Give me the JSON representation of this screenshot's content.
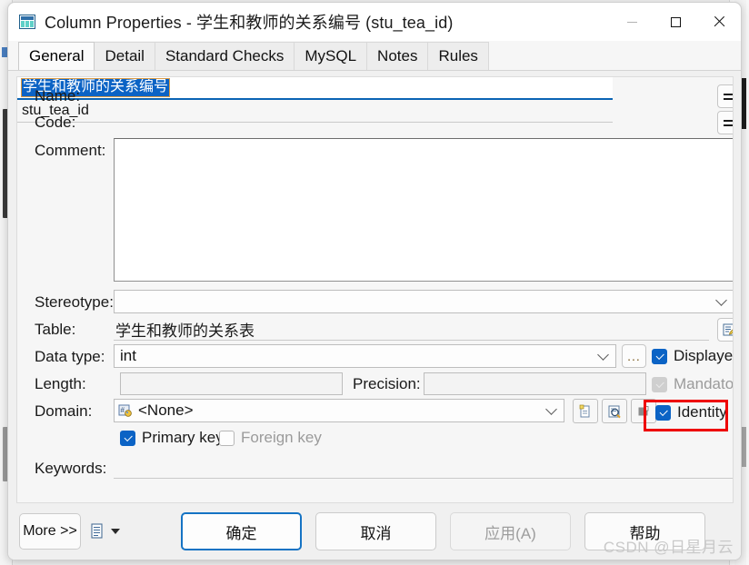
{
  "window": {
    "title": "Column Properties - 学生和教师的关系编号 (stu_tea_id)",
    "app_icon": "table-grid-icon",
    "minimize_label": "Minimize",
    "maximize_label": "Maximize",
    "close_label": "Close"
  },
  "tabs": [
    {
      "label": "General",
      "active": true
    },
    {
      "label": "Detail",
      "active": false
    },
    {
      "label": "Standard Checks",
      "active": false
    },
    {
      "label": "MySQL",
      "active": false
    },
    {
      "label": "Notes",
      "active": false
    },
    {
      "label": "Rules",
      "active": false
    }
  ],
  "form": {
    "name": {
      "label": "Name:",
      "value": "学生和教师的关系编号",
      "selected": true,
      "button": "equals-icon"
    },
    "code": {
      "label": "Code:",
      "value": "stu_tea_id",
      "button": "equals-icon"
    },
    "comment": {
      "label": "Comment:",
      "value": "",
      "placeholder": ""
    },
    "stereotype": {
      "label": "Stereotype:",
      "value": ""
    },
    "table": {
      "label": "Table:",
      "value": "学生和教师的关系表",
      "button": "properties-icon"
    },
    "data_type": {
      "label": "Data type:",
      "value": "int",
      "browse_label": "..."
    },
    "length": {
      "label": "Length:",
      "value": ""
    },
    "precision": {
      "label": "Precision:",
      "value": ""
    },
    "domain": {
      "label": "Domain:",
      "value": "<None>",
      "icon": "domain-icon",
      "buttons": [
        "create-icon",
        "properties-icon",
        "select-icon"
      ]
    },
    "keywords": {
      "label": "Keywords:",
      "value": ""
    }
  },
  "checkboxes": {
    "displayed": {
      "label": "Displayed",
      "checked": true,
      "enabled": true
    },
    "mandatory": {
      "label": "Mandatory",
      "checked": true,
      "enabled": false
    },
    "identity": {
      "label": "Identity",
      "checked": true,
      "enabled": true,
      "highlighted": true
    },
    "primary_key": {
      "label": "Primary key",
      "checked": true,
      "enabled": true
    },
    "foreign_key": {
      "label": "Foreign key",
      "checked": false,
      "enabled": false
    }
  },
  "footer": {
    "more": "More >>",
    "menu_icon": "list-menu-icon",
    "caret_icon": "caret-down-icon",
    "ok": "确定",
    "cancel": "取消",
    "apply": "应用(A)",
    "apply_enabled": false,
    "help": "帮助"
  },
  "annotation": {
    "color": "#ee0000",
    "target": "identity-checkbox"
  },
  "watermark": "CSDN @日星月云"
}
